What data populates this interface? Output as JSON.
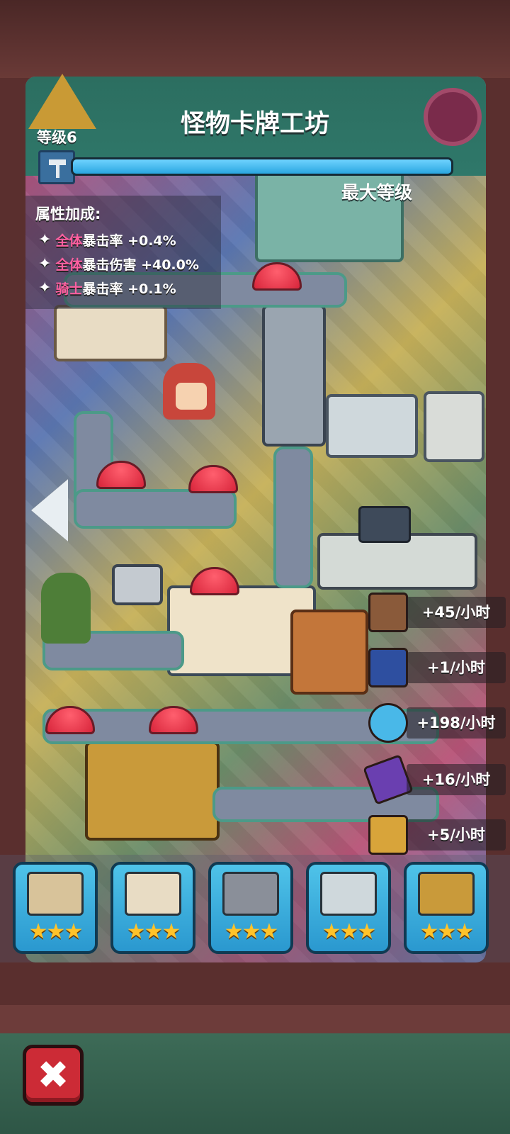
{
  "header": {
    "title": "怪物卡牌工坊",
    "level_label": "等级6",
    "max_level_label": "最大等级",
    "progress": 1.0
  },
  "attributes": {
    "title": "属性加成:",
    "items": [
      {
        "highlight": "全体",
        "text": "暴击率 +0.4%"
      },
      {
        "highlight": "全体",
        "text": "暴击伤害 +40.0%"
      },
      {
        "highlight": "骑士",
        "text": "暴击率 +0.1%"
      }
    ]
  },
  "production_rates": [
    {
      "icon": "crown-card-icon",
      "value": "+45/小时",
      "color": "#8a5a3a"
    },
    {
      "icon": "mystery-card-icon",
      "value": "+1/小时",
      "color": "#2e4fa0"
    },
    {
      "icon": "disc-icon",
      "value": "+198/小时",
      "color": "#49b8e8"
    },
    {
      "icon": "purple-card-icon",
      "value": "+16/小时",
      "color": "#6a3fb0"
    },
    {
      "icon": "mystery-chest-icon",
      "value": "+5/小时",
      "color": "#d8a43a"
    }
  ],
  "machines": [
    {
      "name": "machine-1",
      "stars": "★★★",
      "color": "#d8c39a"
    },
    {
      "name": "machine-2",
      "stars": "★★★",
      "color": "#e8dcc4"
    },
    {
      "name": "machine-3",
      "stars": "★★★",
      "color": "#8a8f99"
    },
    {
      "name": "machine-4",
      "stars": "★★★",
      "color": "#cfd8dc"
    },
    {
      "name": "machine-5",
      "stars": "★★★",
      "color": "#c99a3a"
    }
  ],
  "close_symbol": "✖"
}
